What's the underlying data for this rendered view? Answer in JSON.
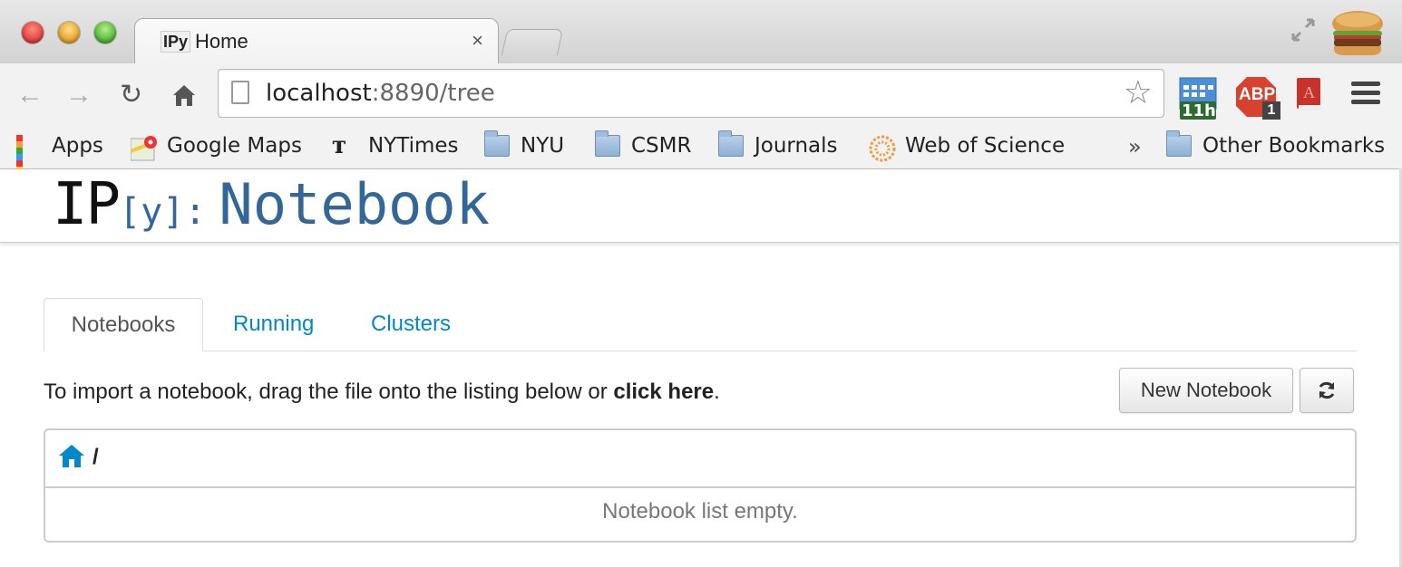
{
  "browser": {
    "tab_title": "Home",
    "tab_favicon_text": "IPy",
    "tab_close": "×",
    "url_host": "localhost",
    "url_rest": ":8890/tree",
    "extensions": {
      "calendar_badge": "11h",
      "adblock_label": "ABP",
      "adblock_count": "1"
    }
  },
  "bookmarks": {
    "items": [
      {
        "label": "Apps",
        "icon": "apps-grid-icon"
      },
      {
        "label": "Google Maps",
        "icon": "maps-icon"
      },
      {
        "label": "NYTimes",
        "icon": "nyt-icon"
      },
      {
        "label": "NYU",
        "icon": "folder-icon"
      },
      {
        "label": "CSMR",
        "icon": "folder-icon"
      },
      {
        "label": "Journals",
        "icon": "folder-icon"
      },
      {
        "label": "Web of Science",
        "icon": "wos-icon"
      }
    ],
    "overflow": "»",
    "other": "Other Bookmarks"
  },
  "ipython": {
    "logo_ip": "IP",
    "logo_y": "[y]:",
    "logo_notebook": "Notebook",
    "tabs": [
      "Notebooks",
      "Running",
      "Clusters"
    ],
    "import_text_prefix": "To import a notebook, drag the file onto the listing below or ",
    "import_link": "click here",
    "import_suffix": ".",
    "new_notebook": "New Notebook",
    "breadcrumb": "/",
    "empty_message": "Notebook list empty."
  },
  "colors": {
    "accent_link": "#0088cc",
    "logo_blue": "#336699"
  }
}
